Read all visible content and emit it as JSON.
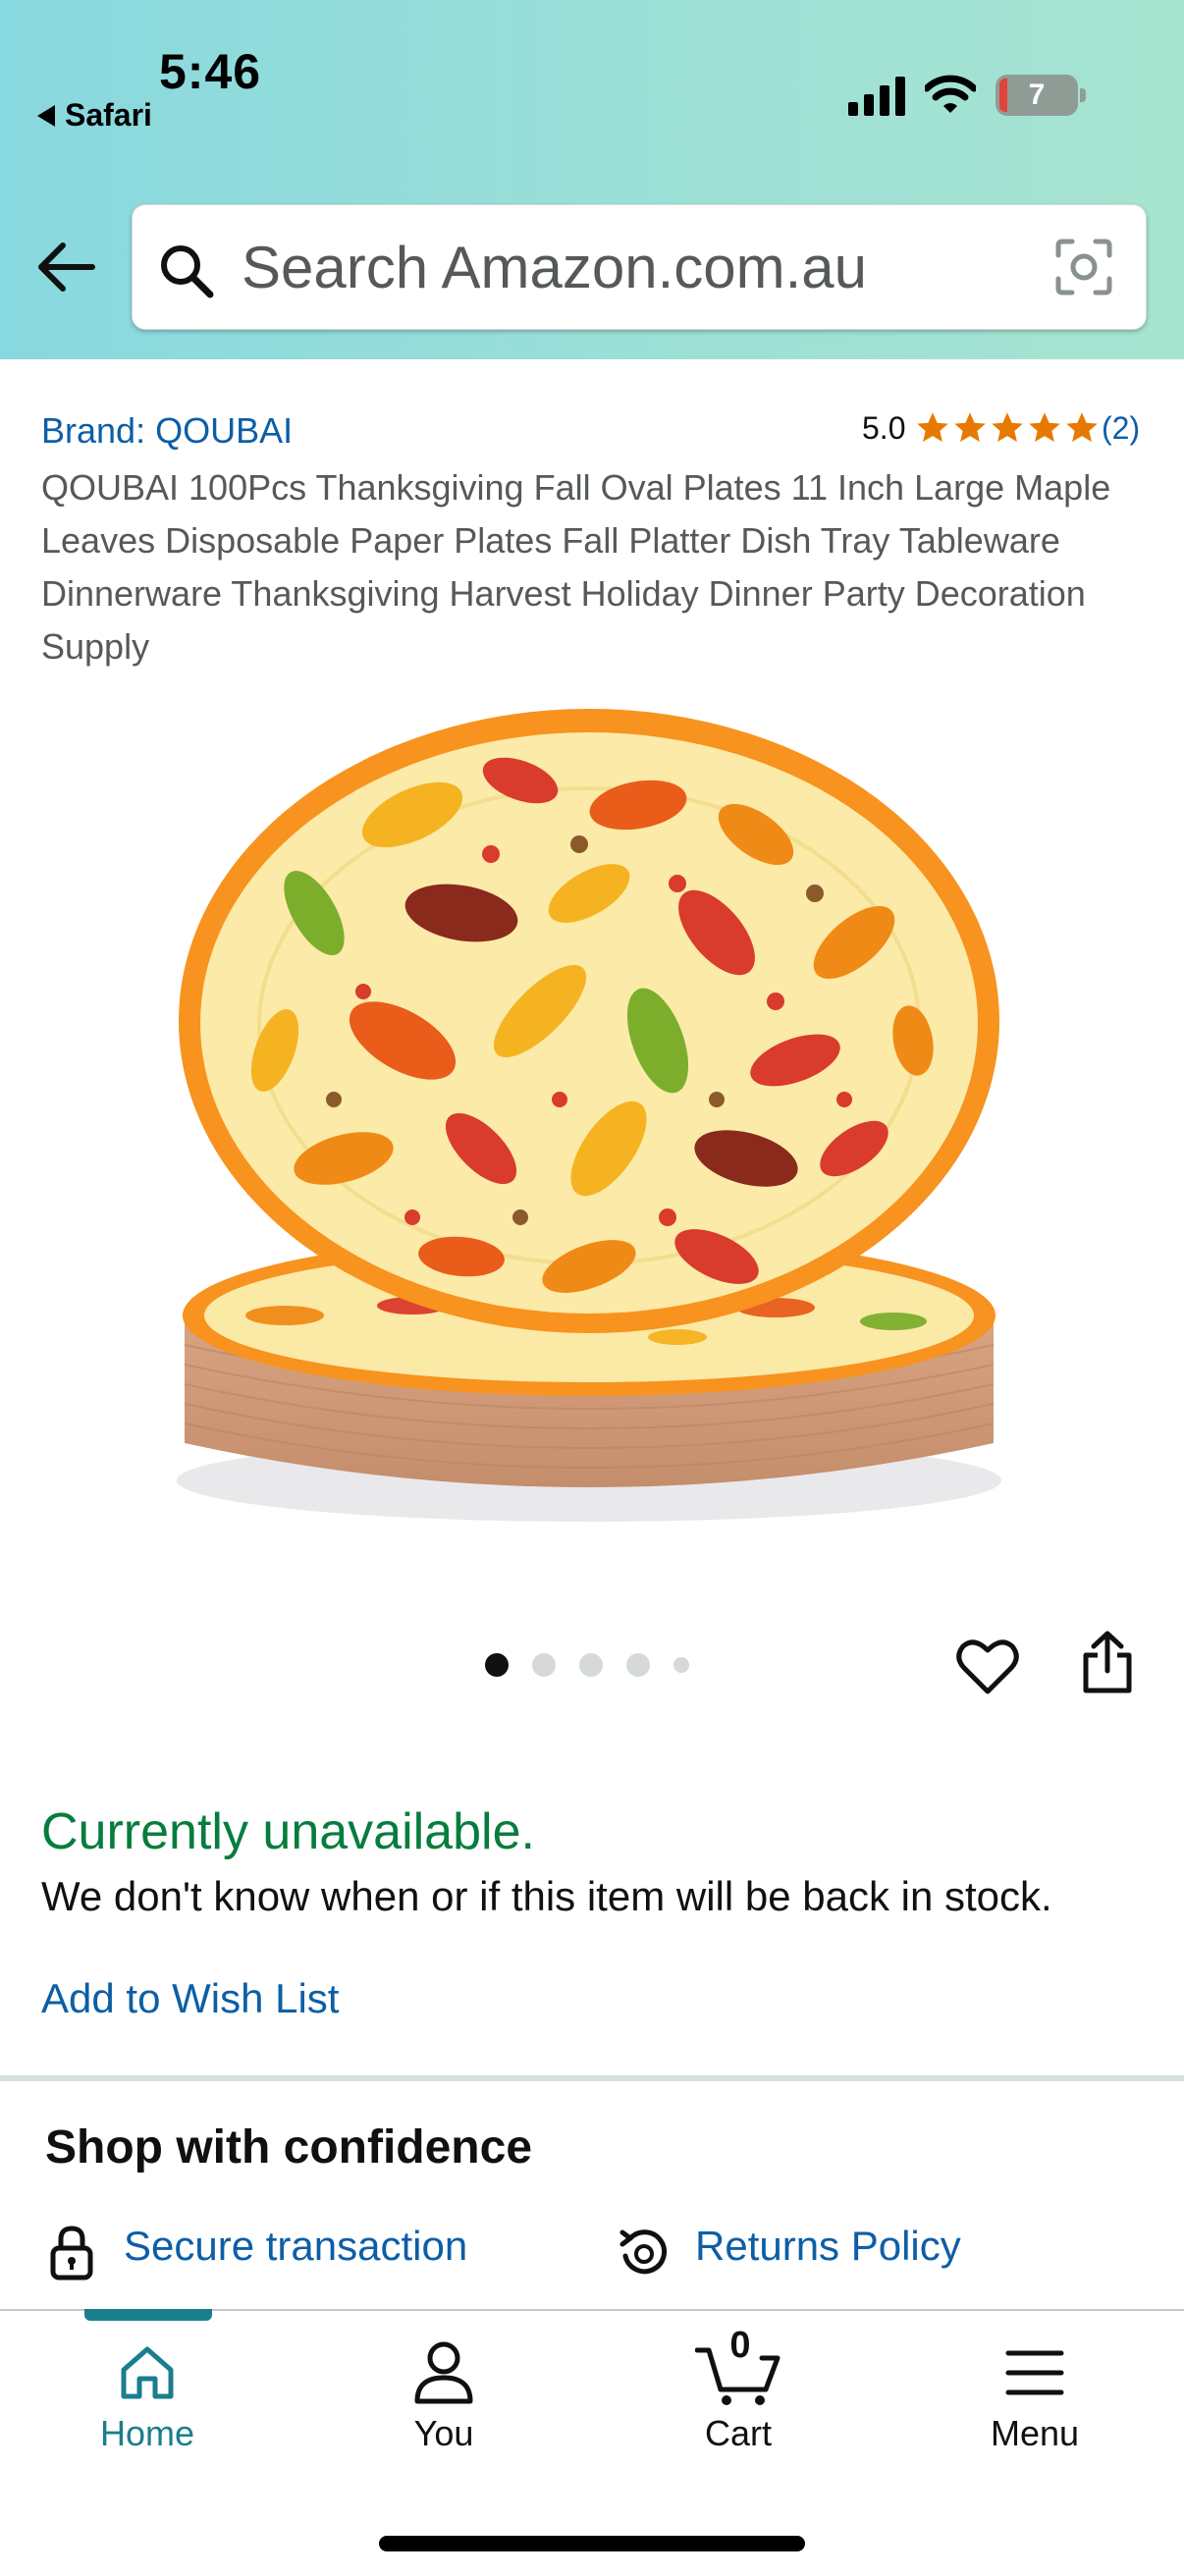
{
  "status_bar": {
    "time": "5:46",
    "back_app": "Safari",
    "battery": "7"
  },
  "search": {
    "placeholder": "Search Amazon.com.au"
  },
  "product": {
    "brand": "Brand: QOUBAI",
    "rating": "5.0",
    "rating_stars": 5,
    "rating_count": "(2)",
    "title": "QOUBAI 100Pcs Thanksgiving Fall Oval Plates 11 Inch Large Maple Leaves Disposable Paper Plates Fall Platter Dish Tray Tableware Dinnerware Thanksgiving Harvest Holiday Dinner Party Decoration Supply"
  },
  "gallery": {
    "dot_count": 5,
    "active_index": 0
  },
  "availability": {
    "status": "Currently unavailable.",
    "message": "We don't know when or if this item will be back in stock.",
    "wishlist_label": "Add to Wish List"
  },
  "confidence": {
    "title": "Shop with confidence",
    "secure_label": "Secure transaction",
    "returns_label": "Returns Policy"
  },
  "nav": {
    "home": "Home",
    "you": "You",
    "cart": "Cart",
    "cart_count": "0",
    "menu": "Menu",
    "active": "home"
  },
  "colors": {
    "link": "#0d5ea6",
    "available_green": "#067d3e",
    "star": "#e67a00",
    "nav_active": "#1a7e8d"
  }
}
